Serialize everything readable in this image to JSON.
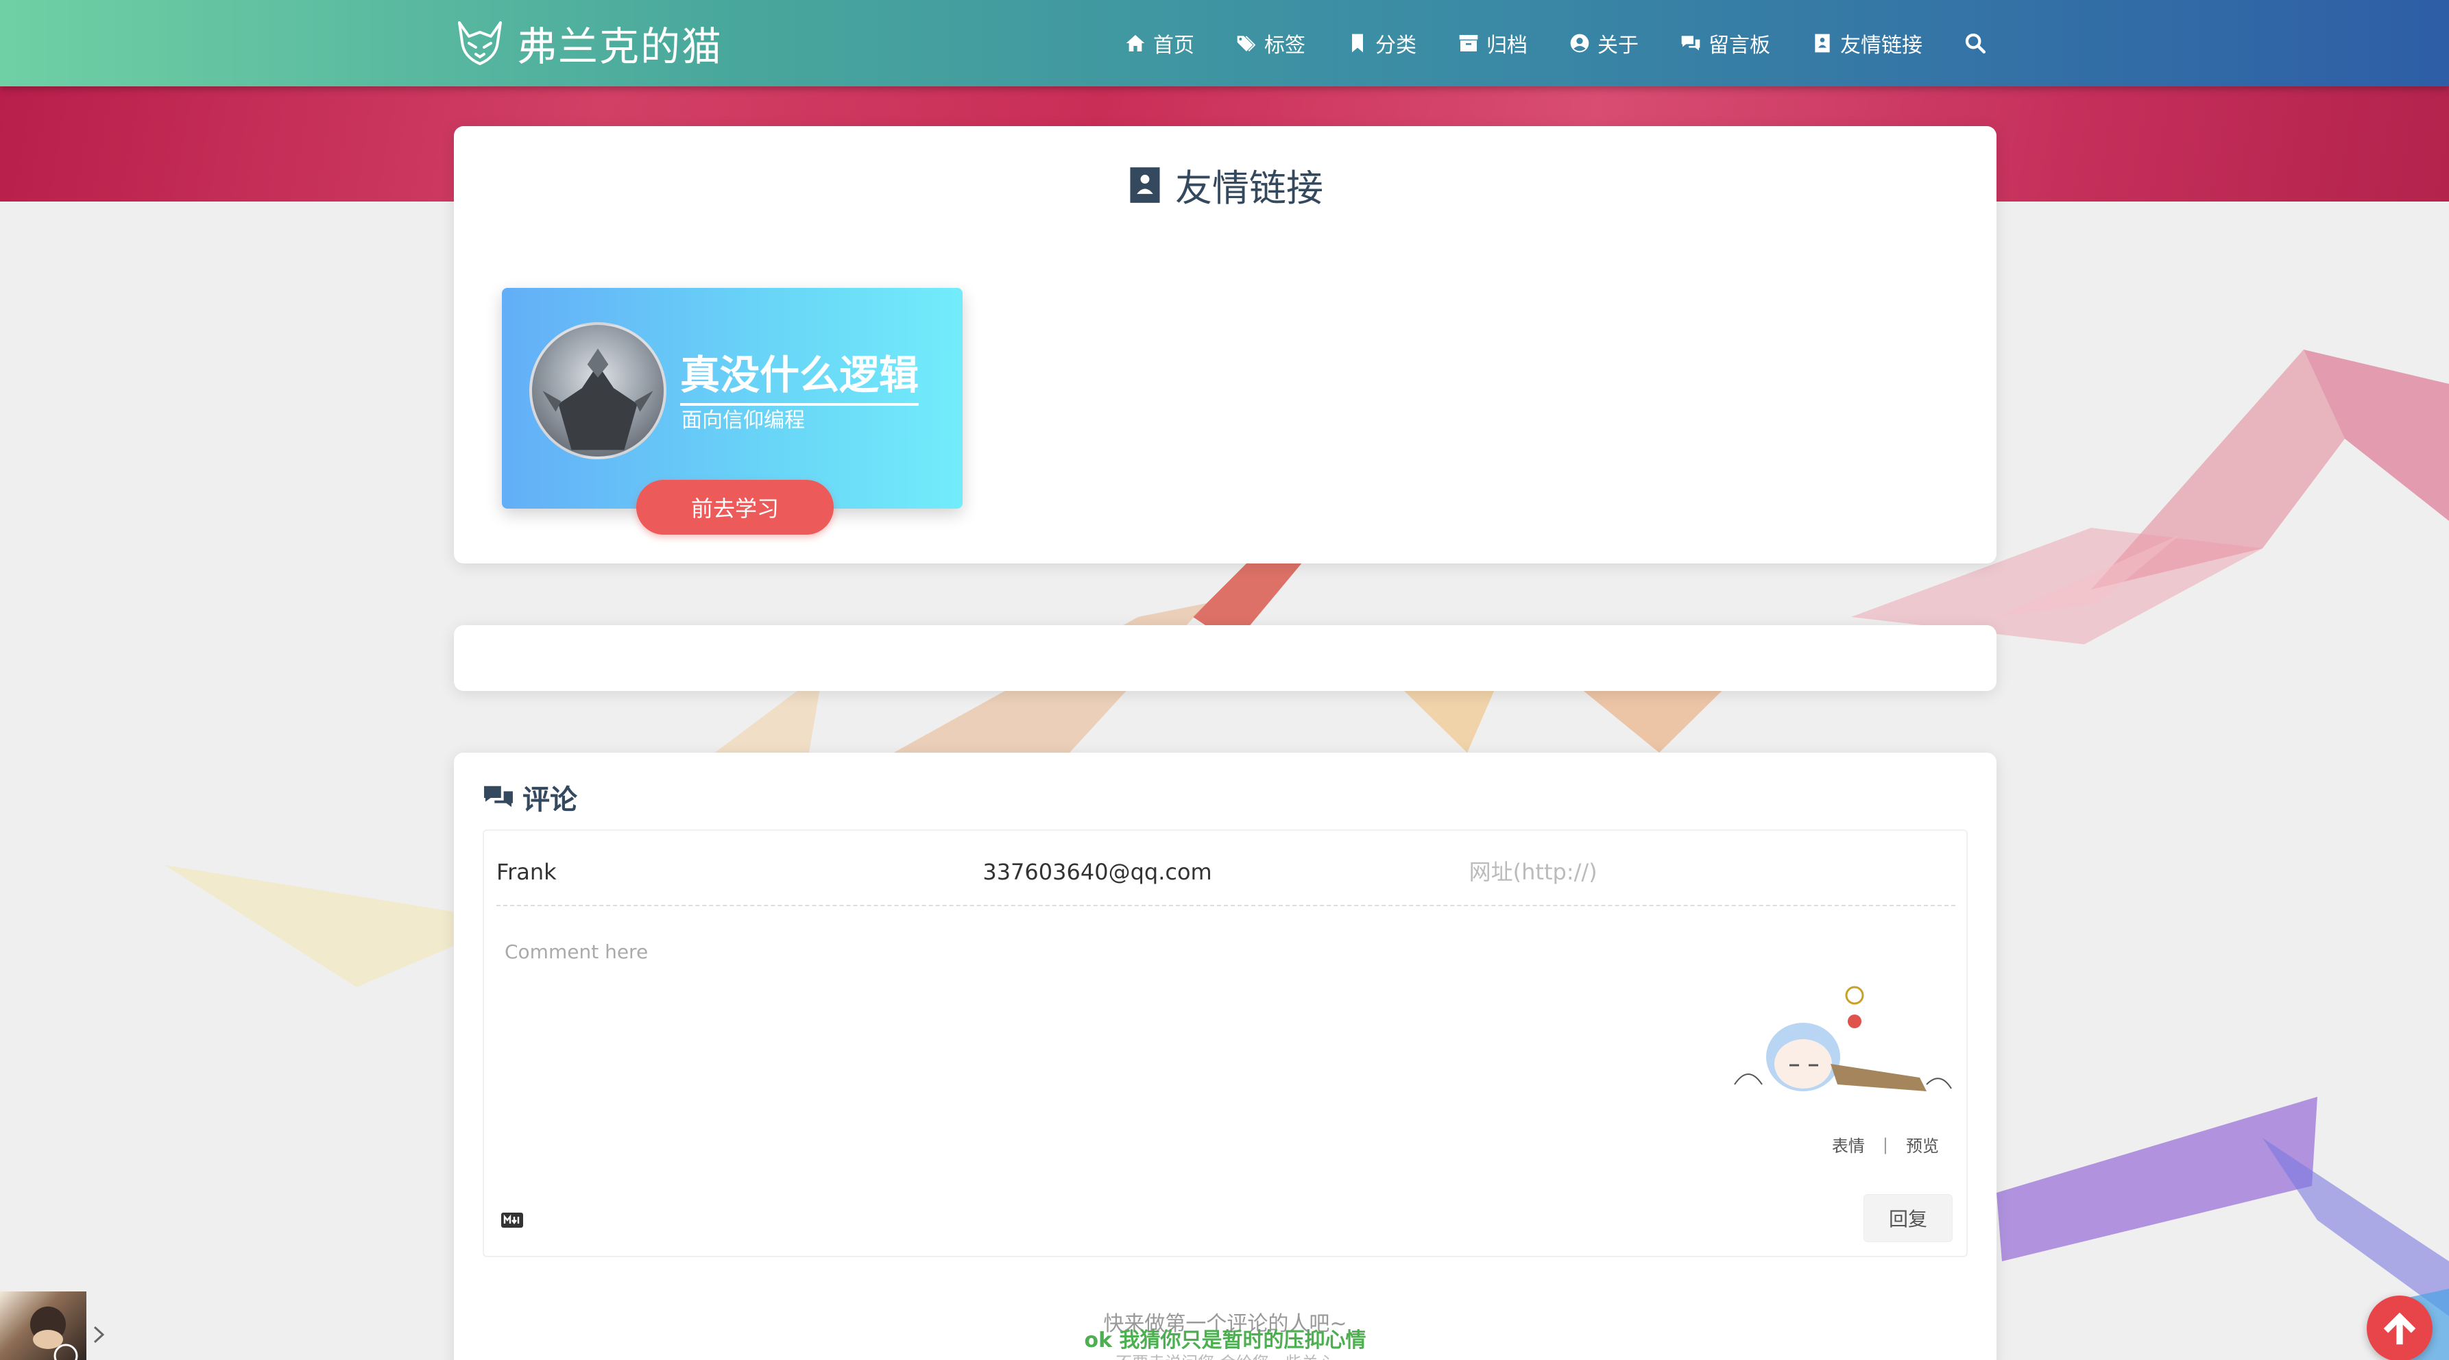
{
  "brand": {
    "title": "弗兰克的猫",
    "logo_icon": "fox-icon"
  },
  "nav": {
    "items": [
      {
        "label": "首页",
        "icon": "home-icon"
      },
      {
        "label": "标签",
        "icon": "tags-icon"
      },
      {
        "label": "分类",
        "icon": "bookmark-icon"
      },
      {
        "label": "归档",
        "icon": "archive-icon"
      },
      {
        "label": "关于",
        "icon": "user-circle-icon"
      },
      {
        "label": "留言板",
        "icon": "comments-icon"
      },
      {
        "label": "友情链接",
        "icon": "address-book-icon"
      }
    ],
    "search_icon": "search-icon"
  },
  "links_page": {
    "title": "友情链接",
    "friends": [
      {
        "name": "真没什么逻辑",
        "desc": "面向信仰编程",
        "button": "前去学习"
      }
    ]
  },
  "comments": {
    "title": "评论",
    "nick_value": "Frank",
    "mail_value": "337603640@qq.com",
    "link_placeholder": "网址(http://)",
    "textarea_placeholder": "Comment here",
    "emoji_label": "表情",
    "separator": "|",
    "preview_label": "预览",
    "reply_label": "回复",
    "empty_text": "快来做第一个评论的人吧~",
    "overlay_text": "ok 我猜你只是暂时的压抑心情",
    "overlay_sub": "不要走说问您 会给您一些关心"
  },
  "colors": {
    "nav_gradient_start": "#6fd0a4",
    "nav_gradient_end": "#2e5ea6",
    "hero_band": "#c92e57",
    "friend_card_start": "#63aef7",
    "friend_card_end": "#72ecfb",
    "learn_button": "#ec5a5a",
    "back_to_top": "#e8454a"
  }
}
